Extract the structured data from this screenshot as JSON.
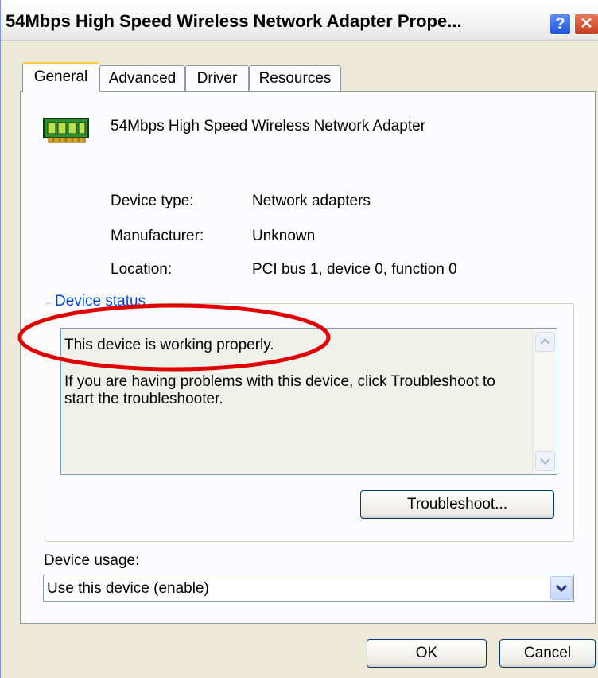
{
  "window": {
    "title": "54Mbps High Speed Wireless Network Adapter Prope...",
    "help_label": "?",
    "close_label": "✕"
  },
  "tabs": [
    {
      "label": "General",
      "active": true
    },
    {
      "label": "Advanced",
      "active": false
    },
    {
      "label": "Driver",
      "active": false
    },
    {
      "label": "Resources",
      "active": false
    }
  ],
  "device": {
    "name": "54Mbps High Speed Wireless Network Adapter",
    "icon": "network-card-icon",
    "properties": [
      {
        "label": "Device type:",
        "value": "Network adapters"
      },
      {
        "label": "Manufacturer:",
        "value": "Unknown"
      },
      {
        "label": "Location:",
        "value": "PCI bus 1, device 0, function 0"
      }
    ]
  },
  "status": {
    "group_label": "Device status",
    "line1": "This device is working properly.",
    "line2": "If you are having problems with this device, click Troubleshoot to",
    "line3": "start the troubleshooter.",
    "troubleshoot_label": "Troubleshoot..."
  },
  "usage": {
    "label": "Device usage:",
    "selected": "Use this device (enable)"
  },
  "footer": {
    "ok_label": "OK",
    "cancel_label": "Cancel"
  },
  "colors": {
    "highlight_ellipse": "#e00000",
    "group_label": "#0046d5",
    "active_tab_accent": "#ffc73c"
  }
}
